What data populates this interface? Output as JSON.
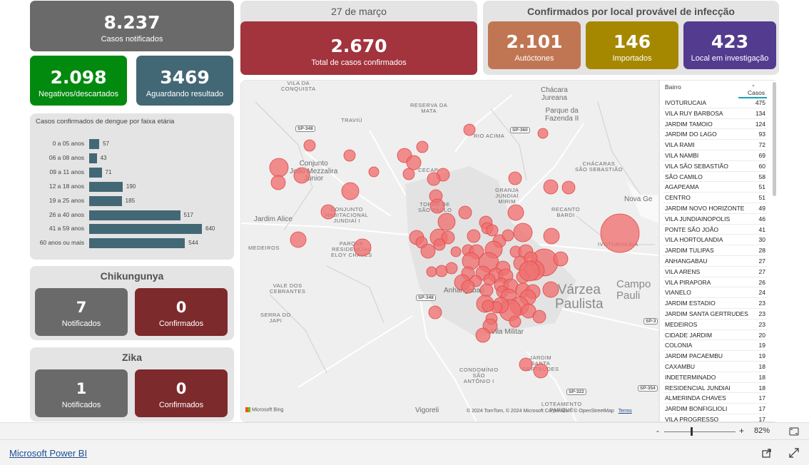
{
  "dengue": {
    "notified_value": "8.237",
    "notified_label": "Casos notificados",
    "negative_value": "2.098",
    "negative_label": "Negativos/descartados",
    "awaiting_value": "3469",
    "awaiting_label": "Aguardando resultado",
    "date": "27 de março",
    "confirmed_value": "2.670",
    "confirmed_label": "Total de casos confirmados"
  },
  "infection_origin": {
    "title": "Confirmados por local provável de infecção",
    "autoctones_value": "2.101",
    "autoctones_label": "Autóctones",
    "importados_value": "146",
    "importados_label": "Importados",
    "investigacao_value": "423",
    "investigacao_label": "Local em investigação"
  },
  "chart_data": {
    "type": "bar",
    "title": "Casos confirmados de dengue por faixa etária",
    "categories": [
      "0 a 05 anos",
      "06 a 08 anos",
      "09 a 11 anos",
      "12 a 18 anos",
      "19 a 25 anos",
      "26 a 40 anos",
      "41 a 59 anos",
      "60 anos ou mais"
    ],
    "values": [
      57,
      43,
      71,
      190,
      185,
      517,
      640,
      544
    ],
    "orientation": "horizontal",
    "color": "#436875"
  },
  "chikungunya": {
    "title": "Chikungunya",
    "notified_value": "7",
    "notified_label": "Notificados",
    "confirmed_value": "0",
    "confirmed_label": "Confirmados"
  },
  "zika": {
    "title": "Zika",
    "notified_value": "1",
    "notified_label": "Notificados",
    "confirmed_value": "0",
    "confirmed_label": "Confirmados"
  },
  "map": {
    "places": {
      "vila_conquista": "VILA DA\nCONQUISTA",
      "traviu": "TRAVIÚ",
      "reserva_mata": "RESERVA DA\nMATA",
      "chacara_jureana": "Chácara\nJureana",
      "parque_fazenda": "Parque da\nFazenda II",
      "rio_acima": "RIO ACIMA",
      "conjunto_joao": "Conjunto\nJoão Mezzalira\nJúnior",
      "chacaras_sebastiao": "CHÁCARAS\nSÃO SEBASTIÃO",
      "granja_mirim": "GRANJA\nJUNDIAÍ\nMIRIM",
      "recanto_bardi": "RECANTO\nBARDI",
      "nova_ge": "Nova Ge",
      "torre_paulo": "TORRE DE\nSÃO PAULO",
      "conjunto_habitacional": "CONJUNTO\nHABITACIONAL\nJUNDIAÍ I",
      "jardim_alice": "Jardim Alice",
      "medeiros": "MEDEIROS",
      "parque_elcy": "PARQUE\nRESIDENCIAL\nELOY CHAVES",
      "ivoturucaia": "IVOTURUCAIA",
      "vale_cebrantes": "VALE DOS\nCEBRANTES",
      "serra_japi": "SERRA DO\nJAPI",
      "anhangabau": "Anhangabaú",
      "varzea": "Várzea\nPaulista",
      "campo": "Campo\nPauli",
      "vila_militar": "Vila Militar",
      "jardim_gertrudes": "JARDIM\nSANTA\nGERTRUDES",
      "condominio": "CONDOMÍNIO\nSÃO\nANTÔNIO I",
      "loteamento": "LOTEAMENTO\nPARQUE",
      "vigoreli": "Vigoreli",
      "cecap": "CECAP"
    },
    "roads": {
      "sp348_a": "SP-348",
      "sp360": "SP-360",
      "sp348_b": "SP-348",
      "sp3": "SP-3",
      "sp322": "SP-322",
      "sp354": "SP-354"
    },
    "bing_label": "Microsoft Bing",
    "credits": "© 2024 TomTom, © 2024 Microsoft Corporation, © OpenStreetMap",
    "terms": "Terms"
  },
  "table": {
    "col_bairro": "Bairro",
    "col_casos": "Casos",
    "rows": [
      {
        "name": "IVOTURUCAIA",
        "value": "475"
      },
      {
        "name": "VILA RUY BARBOSA",
        "value": "134"
      },
      {
        "name": "JARDIM TAMOIO",
        "value": "124"
      },
      {
        "name": "JARDIM DO LAGO",
        "value": "93"
      },
      {
        "name": "VILA RAMI",
        "value": "72"
      },
      {
        "name": "VILA NAMBI",
        "value": "69"
      },
      {
        "name": "VILA SÃO SEBASTIÃO",
        "value": "60"
      },
      {
        "name": "SÃO CAMILO",
        "value": "58"
      },
      {
        "name": "AGAPEAMA",
        "value": "51"
      },
      {
        "name": "CENTRO",
        "value": "51"
      },
      {
        "name": "JARDIM NOVO HORIZONTE",
        "value": "49"
      },
      {
        "name": "VILA JUNDIAINOPOLIS",
        "value": "46"
      },
      {
        "name": "PONTE SÃO JOÃO",
        "value": "41"
      },
      {
        "name": "VILA HORTOLANDIA",
        "value": "30"
      },
      {
        "name": "JARDIM TULIPAS",
        "value": "28"
      },
      {
        "name": "ANHANGABAU",
        "value": "27"
      },
      {
        "name": "VILA ARENS",
        "value": "27"
      },
      {
        "name": "VILA PIRAPORA",
        "value": "26"
      },
      {
        "name": "VIANELO",
        "value": "24"
      },
      {
        "name": "JARDIM ESTADIO",
        "value": "23"
      },
      {
        "name": "JARDIM SANTA GERTRUDES",
        "value": "23"
      },
      {
        "name": "MEDEIROS",
        "value": "23"
      },
      {
        "name": "CIDADE JARDIM",
        "value": "20"
      },
      {
        "name": "COLONIA",
        "value": "19"
      },
      {
        "name": "JARDIM PACAEMBU",
        "value": "19"
      },
      {
        "name": "CAXAMBU",
        "value": "18"
      },
      {
        "name": "INDETERMINADO",
        "value": "18"
      },
      {
        "name": "RESIDENCIAL JUNDIAI",
        "value": "18"
      },
      {
        "name": "ALMERINDA CHAVES",
        "value": "17"
      },
      {
        "name": "JARDIM BONFIGLIOLI",
        "value": "17"
      },
      {
        "name": "VILA PROGRESSO",
        "value": "17"
      }
    ]
  },
  "zoom": {
    "minus": "-",
    "plus": "+",
    "percent": "82%"
  },
  "footer": {
    "link": "Microsoft Power BI"
  },
  "colors": {
    "bubble": "#f07070",
    "green": "#028a0f",
    "red": "#a3333d"
  }
}
